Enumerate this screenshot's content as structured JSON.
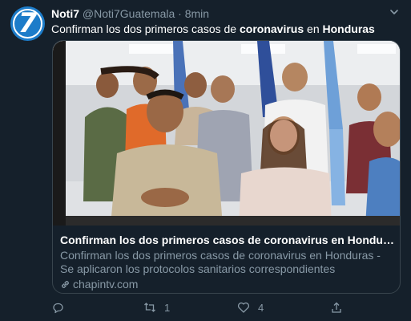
{
  "tweet": {
    "author_name": "Noti7",
    "author_handle": "@Noti7Guatemala",
    "separator": "·",
    "time": "8min",
    "avatar_text": "7",
    "text_parts": [
      "Confirman los dos primeros casos de ",
      "coronavirus",
      " en ",
      "Honduras"
    ]
  },
  "card": {
    "title": "Confirman los dos primeros casos de coronavirus en Honduras - Chapin...",
    "description": "Confirman los dos primeros casos de coronavirus en Honduras - Se aplicaron los protocolos sanitarios correspondientes",
    "domain": "chapintv.com"
  },
  "actions": {
    "reply_count": "",
    "retweet_count": "1",
    "like_count": "4"
  },
  "icons": {
    "caret": "chevron-down-icon",
    "link": "link-icon",
    "reply": "reply-icon",
    "retweet": "retweet-icon",
    "like": "heart-icon",
    "share": "share-icon"
  },
  "colors": {
    "background": "#15202b",
    "secondary_text": "#8899a6",
    "border": "#38444d",
    "avatar": "#1d7cc9"
  }
}
